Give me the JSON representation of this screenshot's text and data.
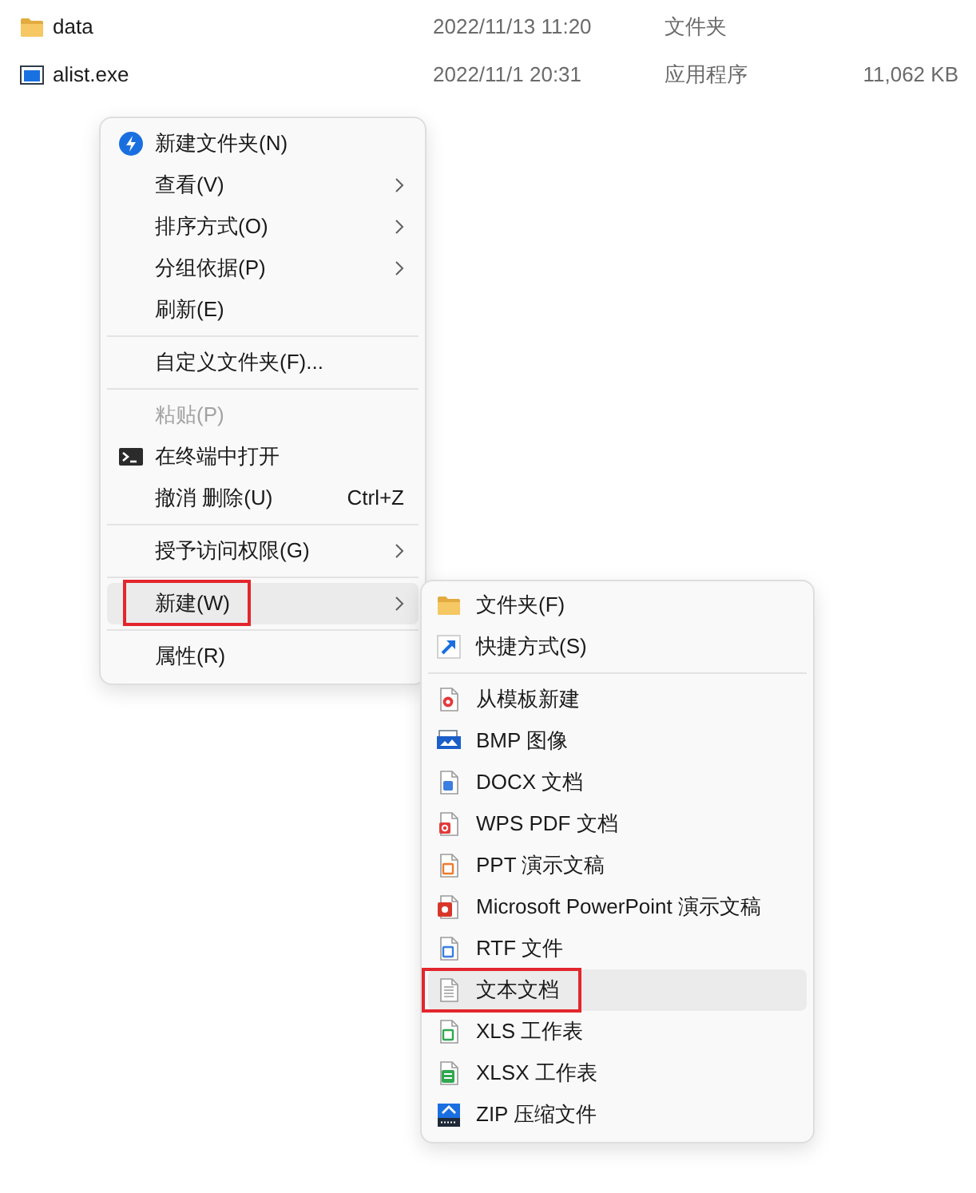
{
  "files": [
    {
      "kind": "folder",
      "name": "data",
      "date": "2022/11/13 11:20",
      "type": "文件夹"
    },
    {
      "kind": "program",
      "name": "alist.exe",
      "date": "2022/11/1 20:31",
      "type": "应用程序",
      "size": "11,062 KB"
    }
  ],
  "context_menu": {
    "items": [
      {
        "kind": "app",
        "label": "新建文件夹(N)",
        "submenu": false,
        "disabled": false,
        "selected": false,
        "outlined": false
      },
      {
        "kind": "plain",
        "label": "查看(V)",
        "submenu": true,
        "disabled": false,
        "selected": false,
        "outlined": false
      },
      {
        "kind": "plain",
        "label": "排序方式(O)",
        "submenu": true,
        "disabled": false,
        "selected": false,
        "outlined": false
      },
      {
        "kind": "plain",
        "label": "分组依据(P)",
        "submenu": true,
        "disabled": false,
        "selected": false,
        "outlined": false
      },
      {
        "kind": "plain",
        "label": "刷新(E)",
        "submenu": false,
        "disabled": false,
        "selected": false,
        "outlined": false
      },
      {
        "kind": "separator"
      },
      {
        "kind": "plain",
        "label": "自定义文件夹(F)...",
        "submenu": false,
        "disabled": false,
        "selected": false,
        "outlined": false
      },
      {
        "kind": "separator"
      },
      {
        "kind": "plain",
        "label": "粘贴(P)",
        "submenu": false,
        "disabled": true,
        "selected": false,
        "outlined": false
      },
      {
        "kind": "terminal",
        "label": "在终端中打开",
        "submenu": false,
        "disabled": false,
        "selected": false,
        "outlined": false
      },
      {
        "kind": "plain",
        "label": "撤消 删除(U)",
        "shortcut": "Ctrl+Z",
        "submenu": false,
        "disabled": false,
        "selected": false,
        "outlined": false
      },
      {
        "kind": "separator"
      },
      {
        "kind": "plain",
        "label": "授予访问权限(G)",
        "submenu": true,
        "disabled": false,
        "selected": false,
        "outlined": false
      },
      {
        "kind": "separator"
      },
      {
        "kind": "plain",
        "label": "新建(W)",
        "submenu": true,
        "disabled": false,
        "selected": true,
        "outlined": true
      },
      {
        "kind": "separator"
      },
      {
        "kind": "plain",
        "label": "属性(R)",
        "submenu": false,
        "disabled": false,
        "selected": false,
        "outlined": false
      }
    ]
  },
  "new_submenu": {
    "items": [
      {
        "kind": "folder",
        "label": "文件夹(F)",
        "selected": false,
        "outlined": false
      },
      {
        "kind": "shortcut",
        "label": "快捷方式(S)",
        "selected": false,
        "outlined": false
      },
      {
        "kind": "separator"
      },
      {
        "kind": "template",
        "label": "从模板新建",
        "selected": false,
        "outlined": false
      },
      {
        "kind": "bmp",
        "label": "BMP 图像",
        "selected": false,
        "outlined": false
      },
      {
        "kind": "docx",
        "label": "DOCX 文档",
        "selected": false,
        "outlined": false
      },
      {
        "kind": "pdf",
        "label": "WPS PDF 文档",
        "selected": false,
        "outlined": false
      },
      {
        "kind": "ppt",
        "label": "PPT 演示文稿",
        "selected": false,
        "outlined": false
      },
      {
        "kind": "pptx",
        "label": "Microsoft PowerPoint 演示文稿",
        "selected": false,
        "outlined": false
      },
      {
        "kind": "rtf",
        "label": "RTF 文件",
        "selected": false,
        "outlined": false
      },
      {
        "kind": "txt",
        "label": "文本文档",
        "selected": true,
        "outlined": true
      },
      {
        "kind": "xls",
        "label": "XLS 工作表",
        "selected": false,
        "outlined": false
      },
      {
        "kind": "xlsx",
        "label": "XLSX 工作表",
        "selected": false,
        "outlined": false
      },
      {
        "kind": "zip",
        "label": "ZIP 压缩文件",
        "selected": false,
        "outlined": false
      }
    ]
  }
}
